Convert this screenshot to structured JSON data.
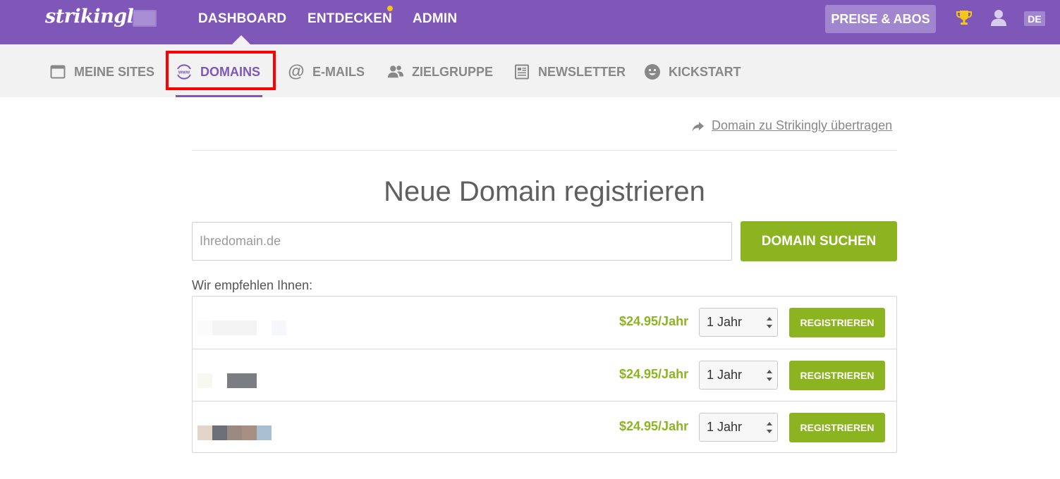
{
  "header": {
    "logo": "strikingly",
    "nav": [
      {
        "label": "DASHBOARD"
      },
      {
        "label": "ENTDECKEN"
      },
      {
        "label": "ADMIN"
      }
    ],
    "pricing_button": "PREISE & ABOS",
    "language": "DE"
  },
  "subnav": {
    "items": [
      {
        "label": "MEINE SITES",
        "icon": "browser-window-icon"
      },
      {
        "label": "DOMAINS",
        "icon": "www-globe-icon",
        "active": true
      },
      {
        "label": "E-MAILS",
        "icon": "at-sign-icon"
      },
      {
        "label": "ZIELGRUPPE",
        "icon": "users-icon"
      },
      {
        "label": "NEWSLETTER",
        "icon": "newsletter-icon"
      },
      {
        "label": "KICKSTART",
        "icon": "smiley-icon"
      }
    ]
  },
  "main": {
    "transfer_link": "Domain zu Strikingly übertragen",
    "heading": "Neue Domain registrieren",
    "search": {
      "placeholder": "Ihredomain.de",
      "value": "",
      "button": "DOMAIN SUCHEN"
    },
    "recommend_label": "Wir empfehlen Ihnen:",
    "recommendations": [
      {
        "price": "$24.95/Jahr",
        "period": "1 Jahr",
        "button": "REGISTRIEREN"
      },
      {
        "price": "$24.95/Jahr",
        "period": "1 Jahr",
        "button": "REGISTRIEREN"
      },
      {
        "price": "$24.95/Jahr",
        "period": "1 Jahr",
        "button": "REGISTRIEREN"
      }
    ]
  },
  "colors": {
    "brand_purple": "#7e57b8",
    "accent_green": "#8bb420",
    "highlight_red": "#ff0000"
  }
}
